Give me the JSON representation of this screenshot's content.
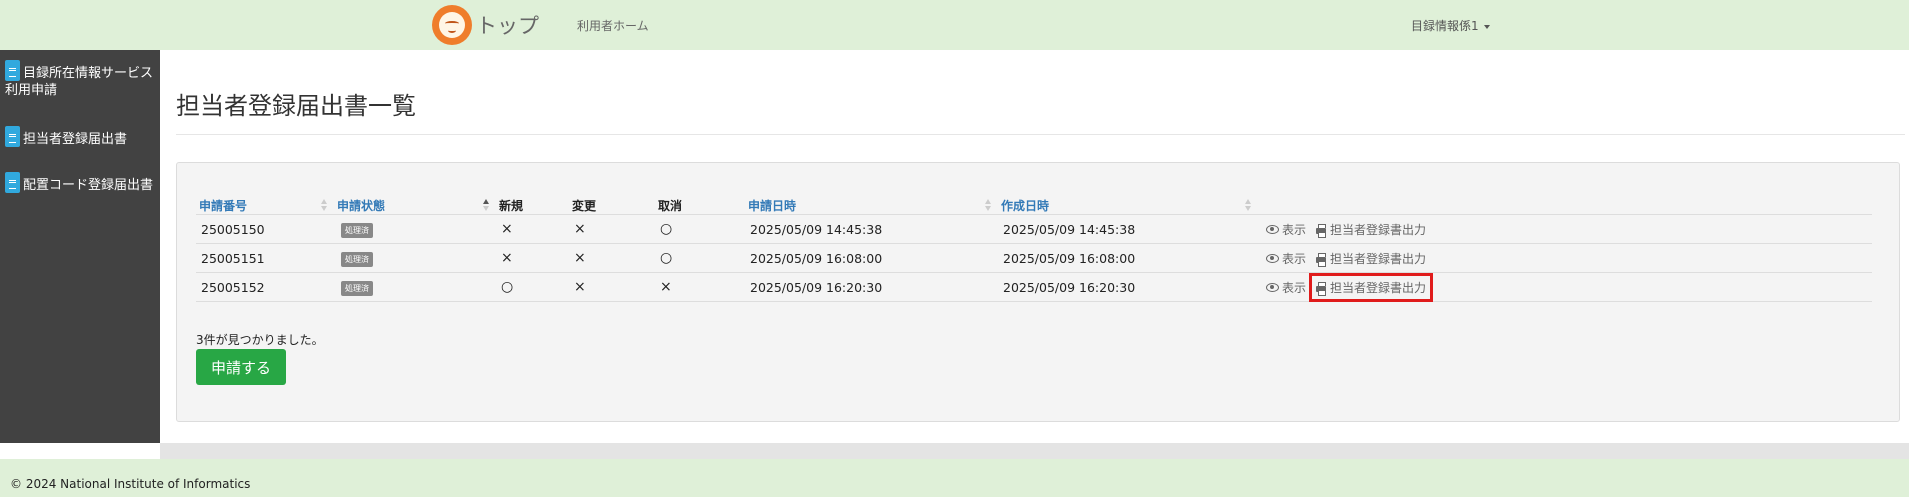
{
  "header": {
    "brand_title": "トップ",
    "home_link": "利用者ホーム",
    "user_menu": "目録情報係1"
  },
  "sidebar": {
    "items": [
      {
        "label": "目録所在情報サービス利用申請",
        "icon": "document-icon"
      },
      {
        "label": "担当者登録届出書",
        "icon": "document-icon"
      },
      {
        "label": "配置コード登録届出書",
        "icon": "document-icon"
      }
    ]
  },
  "page": {
    "title": "担当者登録届出書一覧"
  },
  "table": {
    "headers": {
      "number": "申請番号",
      "status": "申請状態",
      "new": "新規",
      "change": "変更",
      "cancel": "取消",
      "applied_at": "申請日時",
      "created_at": "作成日時"
    },
    "rows": [
      {
        "number": "25005150",
        "status": "処理済",
        "new": "×",
        "change": "×",
        "cancel": "○",
        "applied_at": "2025/05/09 14:45:38",
        "created_at": "2025/05/09 14:45:38",
        "view": "表示",
        "print": "担当者登録書出力"
      },
      {
        "number": "25005151",
        "status": "処理済",
        "new": "×",
        "change": "×",
        "cancel": "○",
        "applied_at": "2025/05/09 16:08:00",
        "created_at": "2025/05/09 16:08:00",
        "view": "表示",
        "print": "担当者登録書出力"
      },
      {
        "number": "25005152",
        "status": "処理済",
        "new": "○",
        "change": "×",
        "cancel": "×",
        "applied_at": "2025/05/09 16:20:30",
        "created_at": "2025/05/09 16:20:30",
        "view": "表示",
        "print": "担当者登録書出力"
      }
    ]
  },
  "result_count": "3件が見つかりました。",
  "apply_button": "申請する",
  "footer": "© 2024 National Institute of Informatics",
  "colors": {
    "header_bg": "#dff0d8",
    "sidebar_bg": "#424242",
    "accent_link": "#337ab7",
    "apply_button": "#28a745",
    "highlight": "#e01b1b",
    "logo": "#ef7d2b"
  }
}
